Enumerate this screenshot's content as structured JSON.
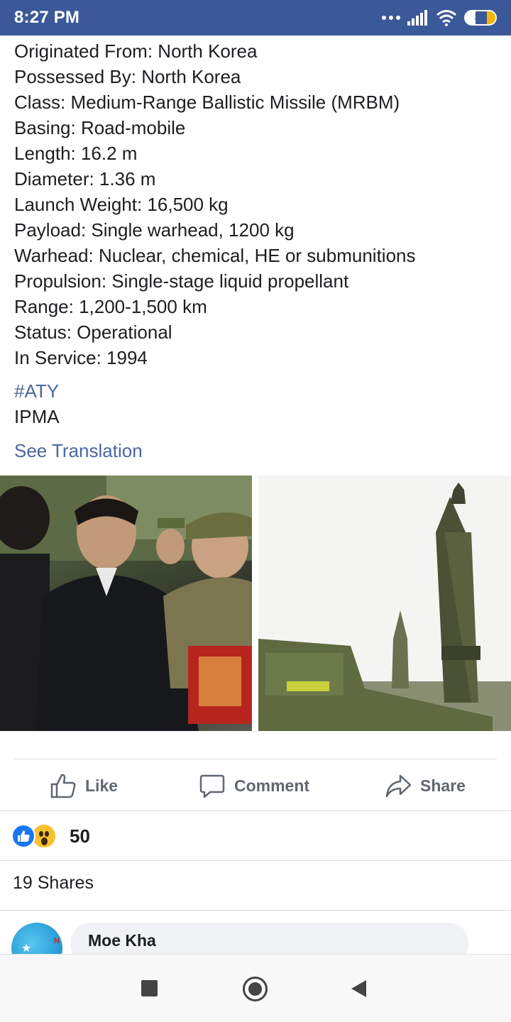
{
  "status_bar": {
    "time": "8:27 PM",
    "battery": "34",
    "battery_level_percent": 34,
    "icons": [
      "more-dots-icon",
      "signal-icon",
      "wifi-icon",
      "battery-icon"
    ]
  },
  "post": {
    "specs": [
      "Originated From: North Korea",
      "Possessed By: North Korea",
      "Class: Medium-Range Ballistic Missile (MRBM)",
      "Basing: Road-mobile",
      "Length: 16.2 m",
      "Diameter: 1.36 m",
      "Launch Weight: 16,500 kg",
      "Payload: Single warhead, 1200 kg",
      "Warhead: Nuclear, chemical, HE or submunitions",
      "Propulsion: Single-stage liquid propellant",
      "Range: 1,200-1,500 km",
      "Status: Operational",
      "In Service: 1994"
    ],
    "hashtag": "#ATY",
    "tag_line": "IPMA",
    "see_translation": "See Translation"
  },
  "actions": {
    "like": "Like",
    "comment": "Comment",
    "share": "Share"
  },
  "reactions": {
    "count": "50",
    "types": [
      "like-reaction-icon",
      "wow-reaction-icon"
    ]
  },
  "shares": "19 Shares",
  "comment_preview": {
    "author": "Moe Kha"
  },
  "colors": {
    "status_bar": "#3b5998",
    "link": "#4b67a1",
    "action_text": "#606770",
    "like_blue": "#1877f2",
    "wow_yellow": "#f7c12e"
  }
}
